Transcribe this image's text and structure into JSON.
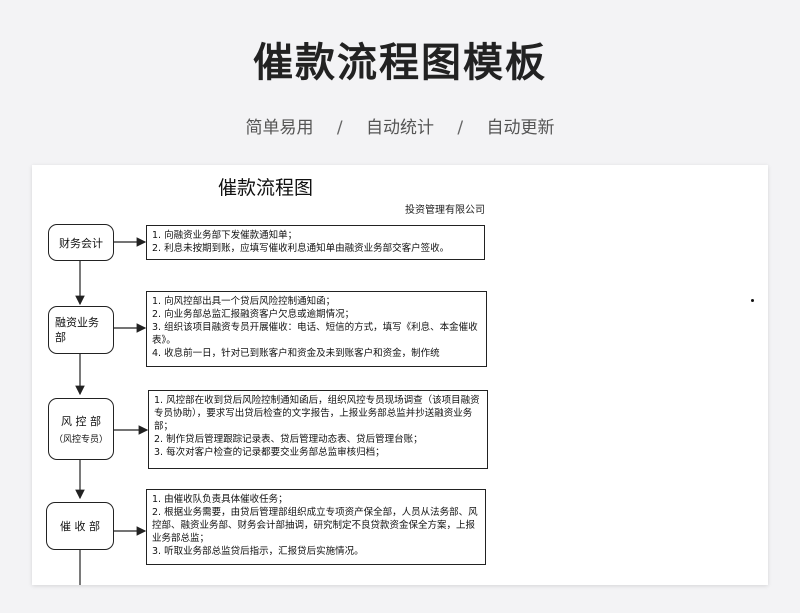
{
  "header": {
    "title": "催款流程图模板",
    "tags": [
      "简单易用",
      "自动统计",
      "自动更新"
    ],
    "separator": "/"
  },
  "document": {
    "title": "催款流程图",
    "company": "投资管理有限公司",
    "steps": [
      {
        "label": "财务会计",
        "notes": [
          "1. 向融资业务部下发催款通知单；",
          "2. 利息未按期到账，应填写催收利息通知单由融资业务部交客户签收。"
        ]
      },
      {
        "label": "融资业务部",
        "notes": [
          "1. 向风控部出具一个贷后风险控制通知函；",
          "2. 向业务部总监汇报融资客户欠息或逾期情况；",
          "3. 组织该项目融资专员开展催收：电话、短信的方式，填写《利息、本金催收表》。",
          "4. 收息前一日，针对已到账客户和资金及未到账客户和资金，制作统"
        ]
      },
      {
        "label": "风 控 部",
        "sublabel": "（风控专员）",
        "notes": [
          "1. 风控部在收到贷后风险控制通知函后，组织风控专员现场调查（该项目融资专员协助），要求写出贷后检查的文字报告，上报业务部总监并抄送融资业务部；",
          "2. 制作贷后管理跟踪记录表、贷后管理动态表、贷后管理台账；",
          "3. 每次对客户检查的记录都要交业务部总监审核归档；"
        ]
      },
      {
        "label": "催 收 部",
        "notes": [
          "1. 由催收队负责具体催收任务；",
          "2. 根据业务需要，由贷后管理部组织成立专项资产保全部，人员从法务部、风控部、融资业务部、财务会计部抽调，研究制定不良贷款资金保全方案，上报业务部总监；",
          "3. 听取业务部总监贷后指示，汇报贷后实施情况。"
        ]
      }
    ]
  }
}
